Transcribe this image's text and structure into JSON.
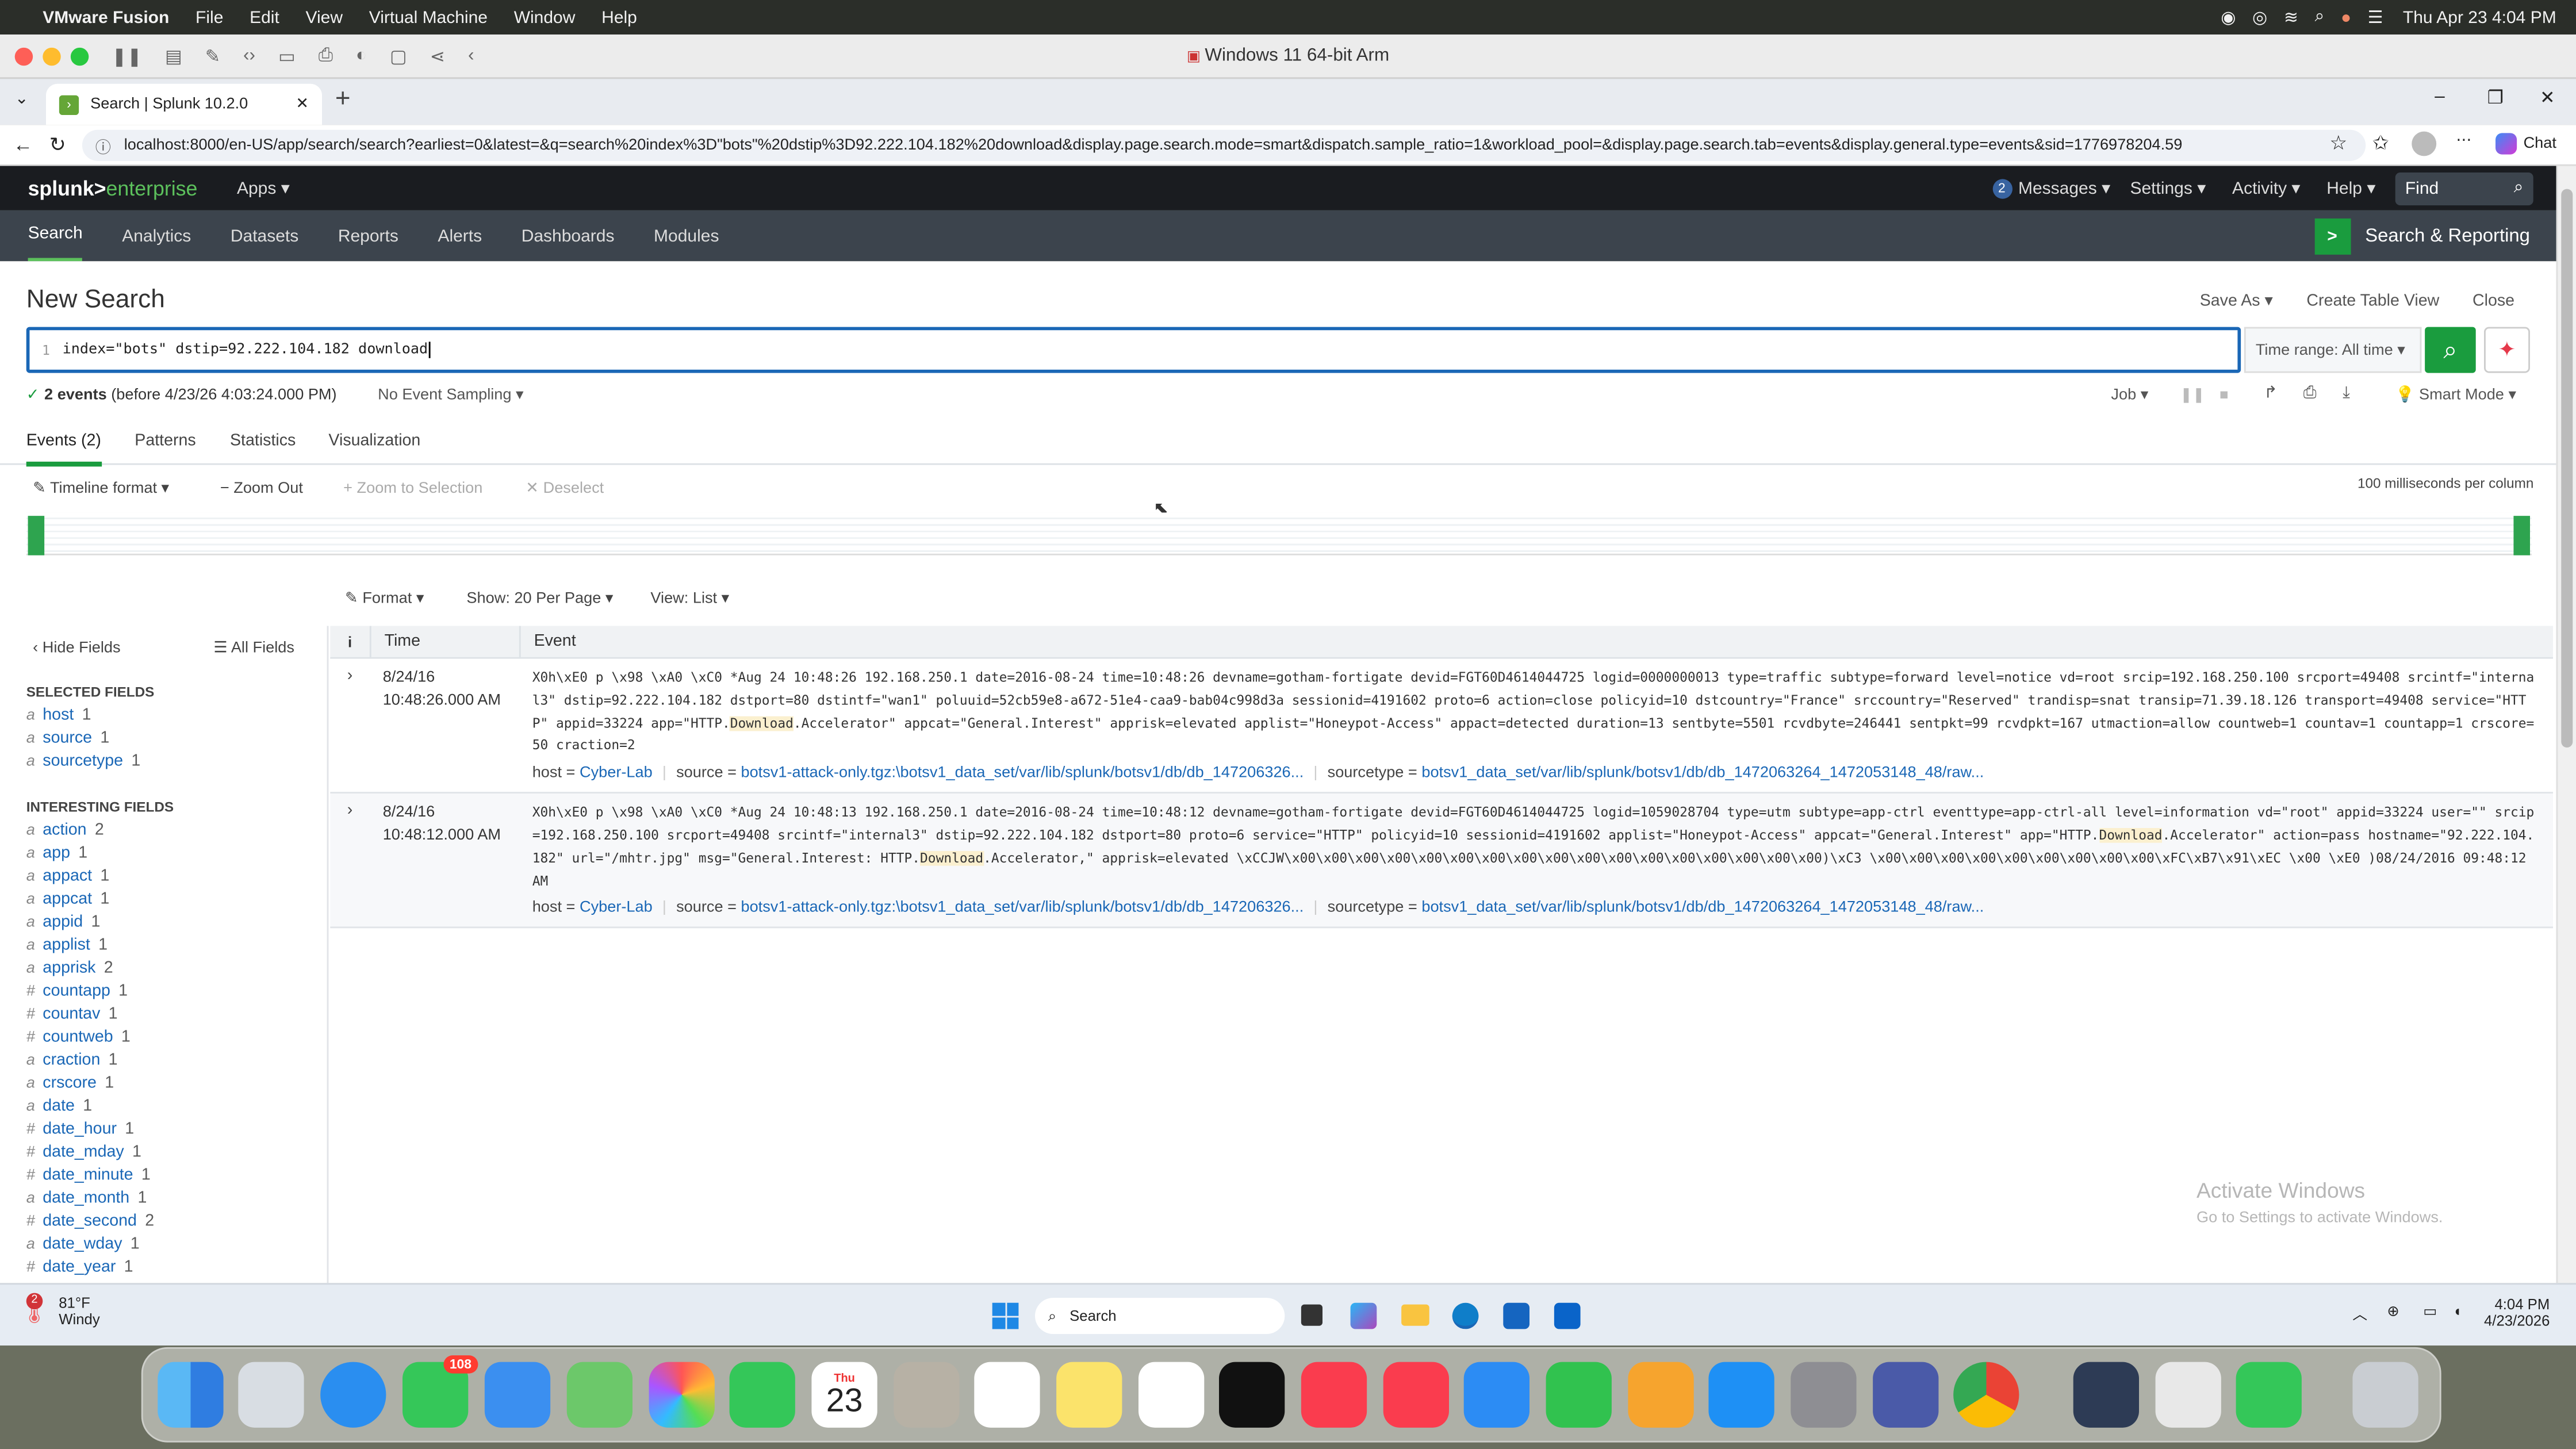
{
  "macos": {
    "app_name": "VMware Fusion",
    "menu": [
      "File",
      "Edit",
      "View",
      "Virtual Machine",
      "Window",
      "Help"
    ],
    "clock": "Thu Apr 23  4:04 PM"
  },
  "vm": {
    "title": "Windows 11 64-bit Arm"
  },
  "browser": {
    "tab_title": "Search | Splunk 10.2.0",
    "url": "localhost:8000/en-US/app/search/search?earliest=0&latest=&q=search%20index%3D\"bots\"%20dstip%3D92.222.104.182%20download&display.page.search.mode=smart&dispatch.sample_ratio=1&workload_pool=&display.page.search.tab=events&display.general.type=events&sid=1776978204.59",
    "chat_label": "Chat"
  },
  "splunk": {
    "logo_a": "splunk>",
    "logo_b": "enterprise",
    "apps": "Apps",
    "messages_count": "2",
    "messages": "Messages",
    "settings": "Settings",
    "activity": "Activity",
    "help": "Help",
    "find_placeholder": "Find",
    "nav": [
      "Search",
      "Analytics",
      "Datasets",
      "Reports",
      "Alerts",
      "Dashboards",
      "Modules"
    ],
    "app_title": "Search & Reporting",
    "page_title": "New Search",
    "save_as": "Save As",
    "create_table": "Create Table View",
    "close": "Close",
    "line_no": "1",
    "query": "index=\"bots\" dstip=92.222.104.182 download",
    "time_range": "Time range: All time",
    "events_count": "2 events",
    "events_before": "(before 4/23/26 4:03:24.000 PM)",
    "sampling": "No Event Sampling",
    "job": "Job",
    "smart_mode": "Smart Mode",
    "result_tabs": [
      "Events (2)",
      "Patterns",
      "Statistics",
      "Visualization"
    ],
    "timeline_format": "Timeline format",
    "zoom_out": "Zoom Out",
    "zoom_selection": "Zoom to Selection",
    "deselect": "Deselect",
    "ms_per_column": "100 milliseconds per column",
    "format": "Format",
    "show_per_page": "Show: 20 Per Page",
    "view_list": "View: List",
    "hide_fields": "Hide Fields",
    "all_fields": "All Fields",
    "selected_fields_header": "SELECTED FIELDS",
    "selected_fields": [
      {
        "type": "a",
        "name": "host",
        "count": "1"
      },
      {
        "type": "a",
        "name": "source",
        "count": "1"
      },
      {
        "type": "a",
        "name": "sourcetype",
        "count": "1"
      }
    ],
    "interesting_fields_header": "INTERESTING FIELDS",
    "interesting_fields": [
      {
        "type": "a",
        "name": "action",
        "count": "2"
      },
      {
        "type": "a",
        "name": "app",
        "count": "1"
      },
      {
        "type": "a",
        "name": "appact",
        "count": "1"
      },
      {
        "type": "a",
        "name": "appcat",
        "count": "1"
      },
      {
        "type": "a",
        "name": "appid",
        "count": "1"
      },
      {
        "type": "a",
        "name": "applist",
        "count": "1"
      },
      {
        "type": "a",
        "name": "apprisk",
        "count": "2"
      },
      {
        "type": "#",
        "name": "countapp",
        "count": "1"
      },
      {
        "type": "#",
        "name": "countav",
        "count": "1"
      },
      {
        "type": "#",
        "name": "countweb",
        "count": "1"
      },
      {
        "type": "a",
        "name": "craction",
        "count": "1"
      },
      {
        "type": "a",
        "name": "crscore",
        "count": "1"
      },
      {
        "type": "a",
        "name": "date",
        "count": "1"
      },
      {
        "type": "#",
        "name": "date_hour",
        "count": "1"
      },
      {
        "type": "#",
        "name": "date_mday",
        "count": "1"
      },
      {
        "type": "#",
        "name": "date_minute",
        "count": "1"
      },
      {
        "type": "a",
        "name": "date_month",
        "count": "1"
      },
      {
        "type": "#",
        "name": "date_second",
        "count": "2"
      },
      {
        "type": "a",
        "name": "date_wday",
        "count": "1"
      },
      {
        "type": "#",
        "name": "date_year",
        "count": "1"
      }
    ],
    "col_info": "i",
    "col_time": "Time",
    "col_event": "Event",
    "events": [
      {
        "date": "8/24/16",
        "time": "10:48:26.000 AM",
        "pre": "X0h\\xE0 p \\x98  \\xA0  \\xC0 *Aug 24 10:48:26 192.168.250.1 date=2016-08-24 time=10:48:26 devname=gotham-fortigate devid=FGT60D4614044725 logid=0000000013 type=traffic subtype=forward level=notice vd=root srcip=192.168.250.100 srcport=49408 srcintf=\"internal3\" dstip=92.222.104.182 dstport=80 dstintf=\"wan1\" poluuid=52cb59e8-a672-51e4-caa9-bab04c998d3a sessionid=4191602 proto=6 action=close policyid=10 dstcountry=\"France\" srccountry=\"Reserved\" trandisp=snat transip=71.39.18.126 transport=49408 service=\"HTTP\" appid=33224 app=\"HTTP.",
        "hl": "Download",
        "post": ".Accelerator\" appcat=\"General.Interest\" apprisk=elevated applist=\"Honeypot-Access\" appact=detected duration=13 sentbyte=5501 rcvdbyte=246441 sentpkt=99 rcvdpkt=167 utmaction=allow countweb=1 countav=1 countapp=1 crscore=50 craction=2",
        "hl2": "",
        "post2": "",
        "host_label": "host =",
        "host": "Cyber-Lab",
        "source_label": "source =",
        "source": "botsv1-attack-only.tgz:\\botsv1_data_set/var/lib/splunk/botsv1/db/db_147206326...",
        "sourcetype_label": "sourcetype =",
        "sourcetype": "botsv1_data_set/var/lib/splunk/botsv1/db/db_1472063264_1472053148_48/raw..."
      },
      {
        "date": "8/24/16",
        "time": "10:48:12.000 AM",
        "pre": "X0h\\xE0 p \\x98  \\xA0  \\xC0 *Aug 24 10:48:13 192.168.250.1 date=2016-08-24 time=10:48:12 devname=gotham-fortigate devid=FGT60D4614044725 logid=1059028704 type=utm subtype=app-ctrl eventtype=app-ctrl-all level=information vd=\"root\" appid=33224 user=\"\" srcip=192.168.250.100 srcport=49408 srcintf=\"internal3\" dstip=92.222.104.182 dstport=80 proto=6 service=\"HTTP\" policyid=10 sessionid=4191602 applist=\"Honeypot-Access\" appcat=\"General.Interest\" app=\"HTTP.",
        "hl": "Download",
        "post": ".Accelerator\" action=pass hostname=\"92.222.104.182\" url=\"/mhtr.jpg\" msg=\"General.Interest: HTTP.",
        "hl2": "Download",
        "post2": ".Accelerator,\" apprisk=elevated    \\xCCJW\\x00\\x00\\x00\\x00\\x00\\x00\\x00\\x00\\x00\\x00\\x00\\x00\\x00\\x00\\x00\\x00\\x00)\\xC3 \\x00\\x00\\x00\\x00\\x00\\x00\\x00\\x00\\x00\\xFC\\xB7\\x91\\xEC \\x00 \\xE0 )08/24/2016 09:48:12 AM",
        "host_label": "host =",
        "host": "Cyber-Lab",
        "source_label": "source =",
        "source": "botsv1-attack-only.tgz:\\botsv1_data_set/var/lib/splunk/botsv1/db/db_147206326...",
        "sourcetype_label": "sourcetype =",
        "sourcetype": "botsv1_data_set/var/lib/splunk/botsv1/db/db_1472063264_1472053148_48/raw..."
      }
    ],
    "watermark_title": "Activate Windows",
    "watermark_sub": "Go to Settings to activate Windows."
  },
  "windows_taskbar": {
    "weather_badge": "2",
    "temp": "81°F",
    "cond": "Windy",
    "search": "Search",
    "time": "4:04 PM",
    "date": "4/23/2026"
  },
  "dock": {
    "messages_badge": "108",
    "calendar_month": "Thu",
    "calendar_day": "23"
  },
  "colors": {
    "splunk_green": "#1a9c3e",
    "accent_blue": "#1a67b6",
    "header_dark": "#1a1c20",
    "nav_gray": "#3c444d"
  }
}
